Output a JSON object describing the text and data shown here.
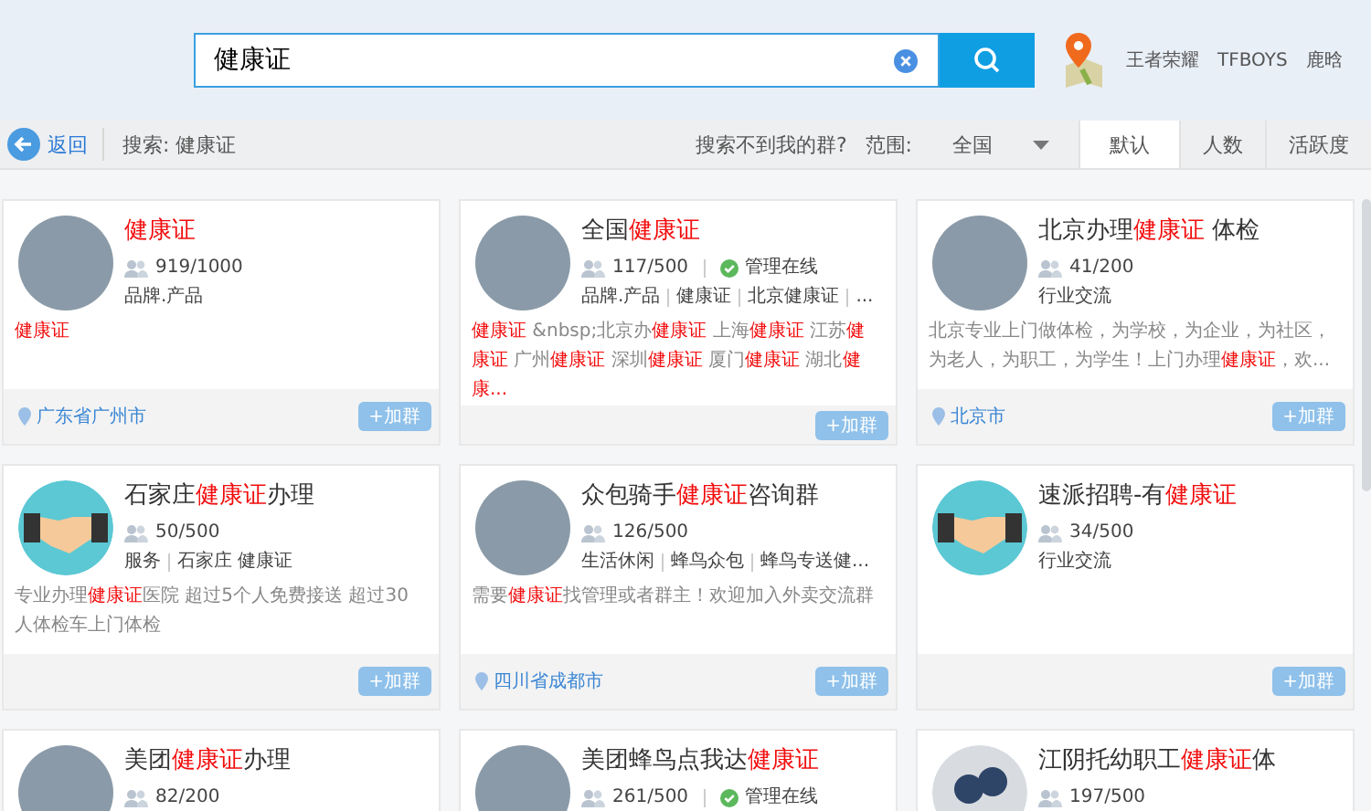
{
  "search": {
    "value": "健康证"
  },
  "hot_links": [
    "王者荣耀",
    "TFBOYS",
    "鹿晗"
  ],
  "toolbar": {
    "back": "返回",
    "query": "搜索: 健康证",
    "help_link": "搜索不到我的群?",
    "scope_label": "范围:",
    "scope_value": "全国"
  },
  "sort_tabs": [
    {
      "label": "默认",
      "selected": true
    },
    {
      "label": "人数",
      "selected": false
    },
    {
      "label": "活跃度",
      "selected": false
    }
  ],
  "groups": [
    {
      "avatar": {
        "kind": "photo"
      },
      "title": [
        {
          "text": "健康证",
          "highlight": true
        }
      ],
      "members": "919/1000",
      "admin_online": false,
      "tags": [
        "品牌.产品"
      ],
      "description": [
        {
          "text": "健康证",
          "highlight": true
        }
      ],
      "location": "广东省广州市",
      "join": "+加群"
    },
    {
      "avatar": {
        "kind": "photo"
      },
      "title": [
        {
          "text": "全国",
          "highlight": false
        },
        {
          "text": "健康证",
          "highlight": true
        }
      ],
      "members": "117/500",
      "admin_online": true,
      "admin_label": "管理在线",
      "tags": [
        "品牌.产品",
        "健康证",
        "北京健康证",
        "..."
      ],
      "description": [
        {
          "text": "健康证",
          "highlight": true
        },
        {
          "text": " &nbsp;北京办",
          "highlight": false
        },
        {
          "text": "健康证",
          "highlight": true
        },
        {
          "text": " 上海",
          "highlight": false
        },
        {
          "text": "健康证",
          "highlight": true
        },
        {
          "text": " 江苏",
          "highlight": false
        },
        {
          "text": "健康证",
          "highlight": true
        },
        {
          "text": " 广州",
          "highlight": false
        },
        {
          "text": "健康证",
          "highlight": true
        },
        {
          "text": " 深圳",
          "highlight": false
        },
        {
          "text": "健康证",
          "highlight": true
        },
        {
          "text": " 厦门",
          "highlight": false
        },
        {
          "text": "健康证",
          "highlight": true
        },
        {
          "text": " 湖北",
          "highlight": false
        },
        {
          "text": "健康...",
          "highlight": true
        }
      ],
      "join": "+加群"
    },
    {
      "avatar": {
        "kind": "photo"
      },
      "title": [
        {
          "text": "北京办理",
          "highlight": false
        },
        {
          "text": "健康证",
          "highlight": true
        },
        {
          "text": " 体检",
          "highlight": false
        }
      ],
      "members": "41/200",
      "admin_online": false,
      "tags": [
        "行业交流"
      ],
      "description": [
        {
          "text": "北京专业上门做体检，为学校，为企业，为社区，为老人，为职工，为学生！上门办理",
          "highlight": false
        },
        {
          "text": "健康证",
          "highlight": true
        },
        {
          "text": "，欢...",
          "highlight": false
        }
      ],
      "location": "北京市",
      "join": "+加群"
    },
    {
      "avatar": {
        "kind": "handshake"
      },
      "title": [
        {
          "text": "石家庄",
          "highlight": false
        },
        {
          "text": "健康证",
          "highlight": true
        },
        {
          "text": "办理",
          "highlight": false
        }
      ],
      "members": "50/500",
      "admin_online": false,
      "tags": [
        "服务",
        "石家庄 健康证"
      ],
      "description": [
        {
          "text": "专业办理",
          "highlight": false
        },
        {
          "text": "健康证",
          "highlight": true
        },
        {
          "text": "医院 超过5个人免费接送 超过30人体检车上门体检",
          "highlight": false
        }
      ],
      "join": "+加群"
    },
    {
      "avatar": {
        "kind": "photo"
      },
      "title": [
        {
          "text": "众包骑手",
          "highlight": false
        },
        {
          "text": "健康证",
          "highlight": true
        },
        {
          "text": "咨询群",
          "highlight": false
        }
      ],
      "members": "126/500",
      "admin_online": false,
      "tags": [
        "生活休闲",
        "蜂鸟众包",
        "蜂鸟专送健..."
      ],
      "description": [
        {
          "text": "需要",
          "highlight": false
        },
        {
          "text": "健康证",
          "highlight": true
        },
        {
          "text": "找管理或者群主！欢迎加入外卖交流群",
          "highlight": false
        }
      ],
      "location": "四川省成都市",
      "join": "+加群"
    },
    {
      "avatar": {
        "kind": "handshake"
      },
      "title": [
        {
          "text": "速派招聘-有",
          "highlight": false
        },
        {
          "text": "健康证",
          "highlight": true
        }
      ],
      "members": "34/500",
      "admin_online": false,
      "tags": [
        "行业交流"
      ],
      "join": "+加群"
    },
    {
      "avatar": {
        "kind": "photo"
      },
      "title": [
        {
          "text": "美团",
          "highlight": false
        },
        {
          "text": "健康证",
          "highlight": true
        },
        {
          "text": "办理",
          "highlight": false
        }
      ],
      "members": "82/200",
      "admin_online": false
    },
    {
      "avatar": {
        "kind": "photo"
      },
      "title": [
        {
          "text": "美团蜂鸟点我达",
          "highlight": false
        },
        {
          "text": "健康证",
          "highlight": true
        }
      ],
      "members": "261/500",
      "admin_online": true,
      "admin_label": "管理在线"
    },
    {
      "avatar": {
        "kind": "person"
      },
      "title": [
        {
          "text": "江阴托幼职工",
          "highlight": false
        },
        {
          "text": "健康证",
          "highlight": true
        },
        {
          "text": "体",
          "highlight": false
        }
      ],
      "members": "197/500",
      "admin_online": false
    }
  ]
}
